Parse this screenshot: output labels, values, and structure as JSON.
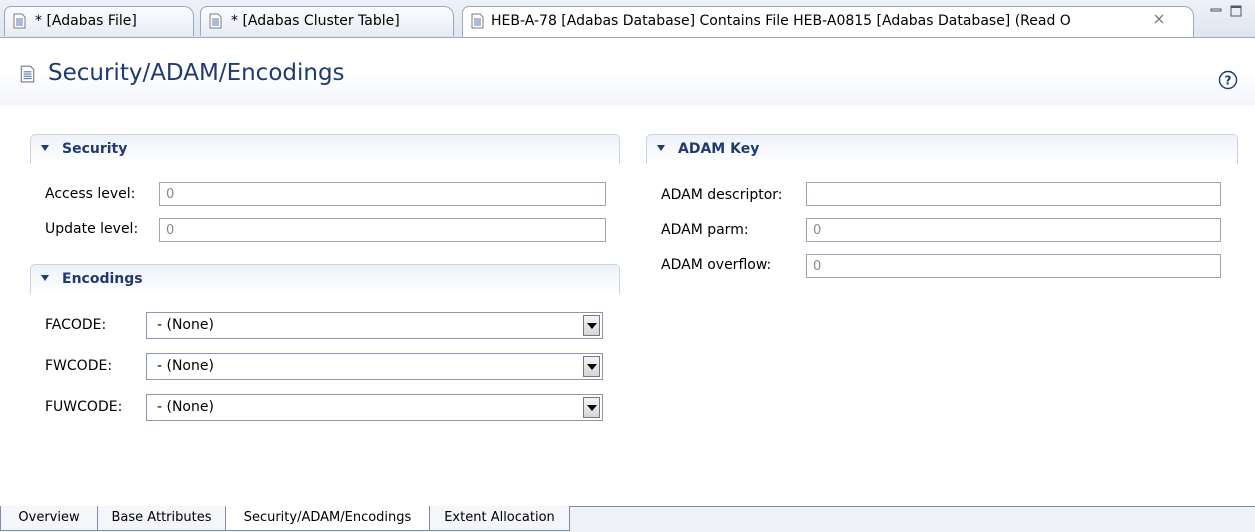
{
  "editor_tabs": [
    {
      "label": "* [Adabas File]",
      "active": false
    },
    {
      "label": "* [Adabas Cluster Table]",
      "active": false
    },
    {
      "label": "HEB-A-78 [Adabas Database] Contains File HEB-A0815 [Adabas Database] (Read O",
      "active": true
    }
  ],
  "window_controls": {
    "minimize": "minimize-icon",
    "maximize": "maximize-icon"
  },
  "form": {
    "title": "Security/ADAM/Encodings"
  },
  "security": {
    "title": "Security",
    "access_level_label": "Access level:",
    "access_level_value": "0",
    "update_level_label": "Update level:",
    "update_level_value": "0"
  },
  "encodings": {
    "title": "Encodings",
    "facode_label": "FACODE:",
    "facode_value": "- (None)",
    "fwcode_label": "FWCODE:",
    "fwcode_value": "- (None)",
    "fuwcode_label": "FUWCODE:",
    "fuwcode_value": "- (None)"
  },
  "adam": {
    "title": "ADAM Key",
    "descriptor_label": "ADAM descriptor:",
    "descriptor_value": "",
    "parm_label": "ADAM parm:",
    "parm_value": "0",
    "overflow_label": "ADAM overflow:",
    "overflow_value": "0"
  },
  "page_tabs": [
    {
      "label": "Overview",
      "active": false
    },
    {
      "label": "Base Attributes",
      "active": false
    },
    {
      "label": "Security/ADAM/Encodings",
      "active": true
    },
    {
      "label": "Extent Allocation",
      "active": false
    }
  ],
  "colors": {
    "title": "#1f3a72",
    "accent": "#9aa7bd"
  }
}
